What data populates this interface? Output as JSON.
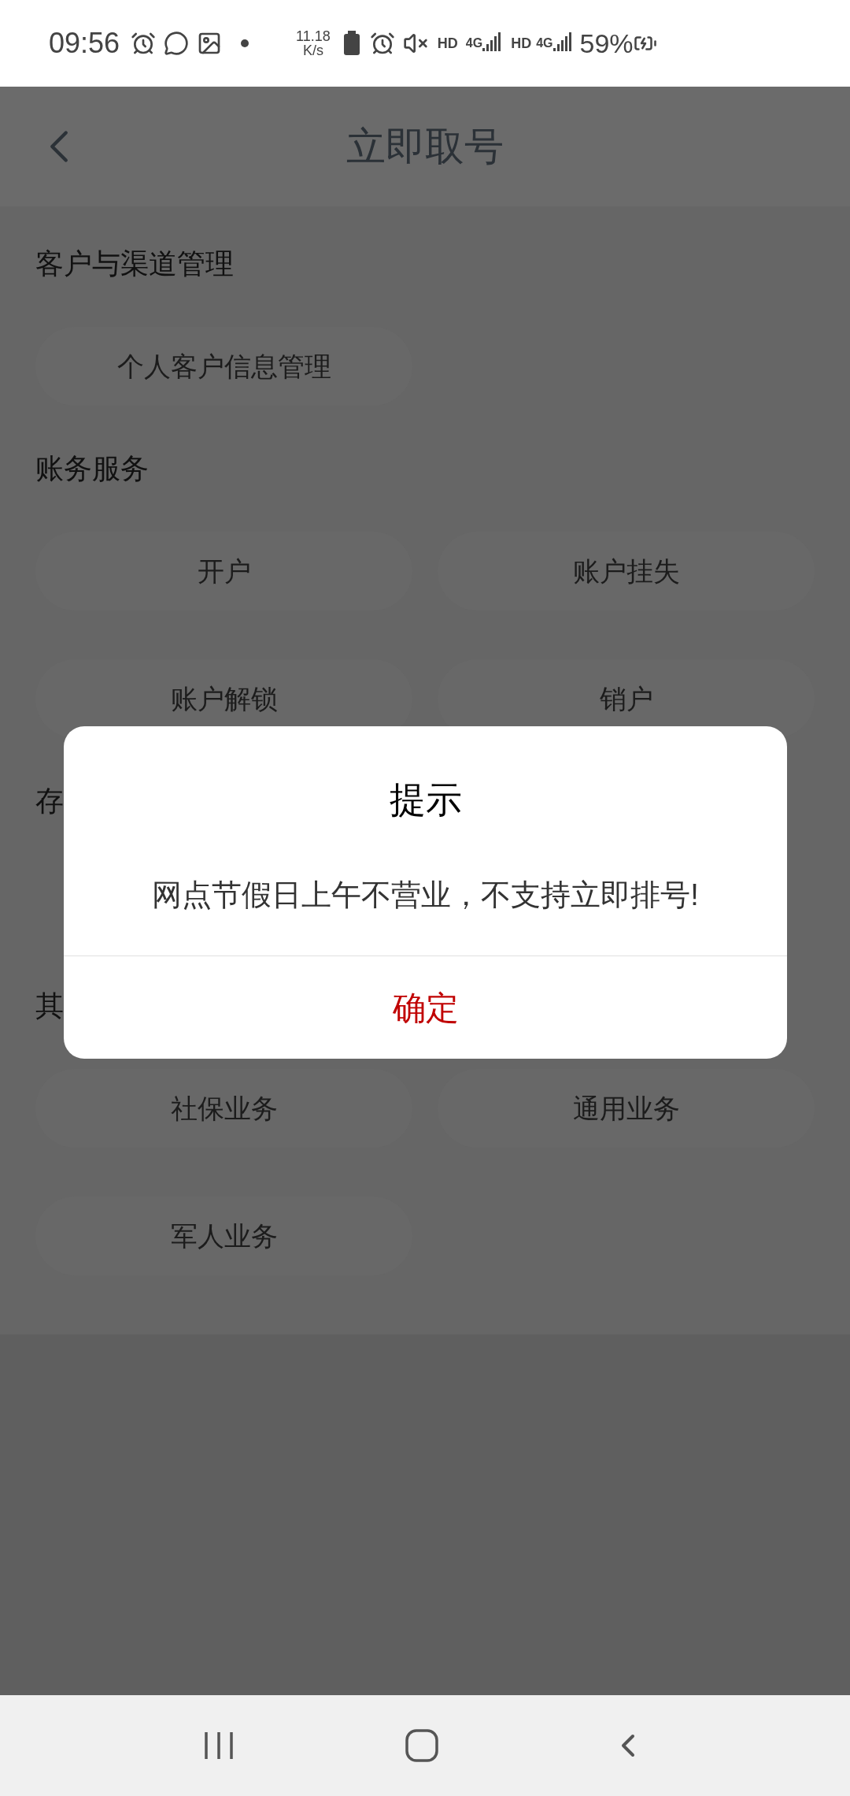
{
  "status_bar": {
    "time": "09:56",
    "speed_value": "11.18",
    "speed_unit": "K/s",
    "hd_1": "HD",
    "net_1": "4G",
    "hd_2": "HD",
    "net_2": "4G",
    "battery": "59%"
  },
  "header": {
    "title": "立即取号"
  },
  "sections": [
    {
      "title": "客户与渠道管理",
      "buttons": [
        {
          "kind": "label",
          "label": "个人客户信息管理"
        }
      ]
    },
    {
      "title": "账务服务",
      "buttons": [
        {
          "kind": "label",
          "label": "开户"
        },
        {
          "kind": "label",
          "label": "账户挂失"
        },
        {
          "kind": "label",
          "label": "账户解锁"
        },
        {
          "kind": "label",
          "label": "销户"
        }
      ]
    },
    {
      "title": "存"
    },
    {
      "title": "其",
      "buttons": [
        {
          "kind": "label",
          "label": "社保业务"
        },
        {
          "kind": "label",
          "label": "通用业务"
        },
        {
          "kind": "label",
          "label": "军人业务"
        }
      ]
    }
  ],
  "dialog": {
    "title": "提示",
    "message": "网点节假日上午不营业，不支持立即排号!",
    "confirm": "确定"
  }
}
